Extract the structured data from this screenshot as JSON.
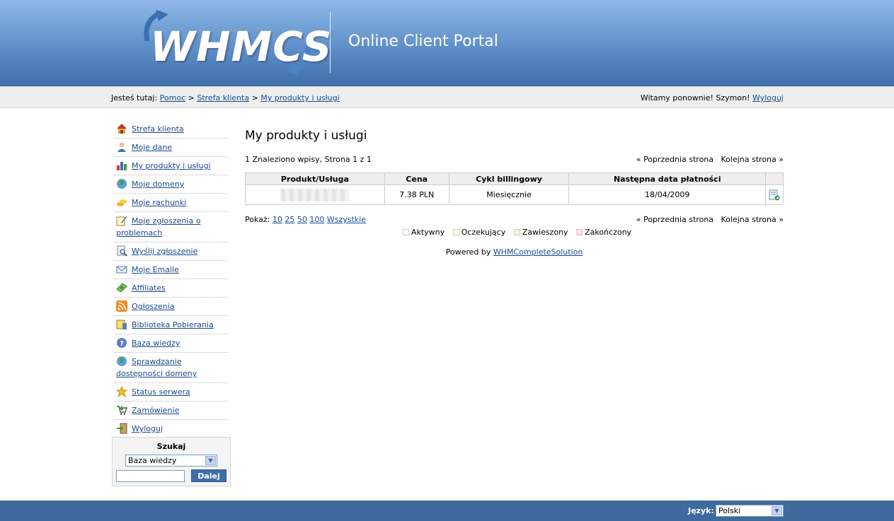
{
  "header": {
    "logo_text": "WHMCS",
    "portal_title": "Online Client Portal"
  },
  "breadcrumb": {
    "prefix": "Jesteś tutaj:",
    "items": [
      "Pomoc",
      "Strefa klienta",
      "My produkty i usługi"
    ],
    "separator": ">"
  },
  "welcome": {
    "text": "Witamy ponownie! Szymon!",
    "logout": "Wyloguj"
  },
  "sidebar": {
    "items": [
      {
        "label": "Strefa klienta",
        "icon": "home-icon"
      },
      {
        "label": "Moje dane",
        "icon": "user-icon"
      },
      {
        "label": "My produkty i usługi",
        "icon": "bar-chart-icon"
      },
      {
        "label": "Moje domeny",
        "icon": "globe-icon"
      },
      {
        "label": "Moje rachunki",
        "icon": "coins-icon"
      },
      {
        "label": "Moje zgłoszenia o problemach",
        "icon": "ticket-edit-icon"
      },
      {
        "label": "Wyślij zgłoszenie",
        "icon": "magnifier-doc-icon"
      },
      {
        "label": "Moje Emaile",
        "icon": "envelope-icon"
      },
      {
        "label": "Affiliates",
        "icon": "money-icon"
      },
      {
        "label": "Ogłoszenia",
        "icon": "rss-icon"
      },
      {
        "label": "Biblioteka Pobierania",
        "icon": "download-icon"
      },
      {
        "label": "Baza wiedzy",
        "icon": "help-icon"
      },
      {
        "label": "Sprawdzanie dostępności domeny",
        "icon": "globe-check-icon"
      },
      {
        "label": "Status serwera",
        "icon": "star-icon"
      },
      {
        "label": "Zamówienie",
        "icon": "cart-icon"
      },
      {
        "label": "Wyloguj",
        "icon": "logout-icon"
      }
    ]
  },
  "search": {
    "title": "Szukaj",
    "selected": "Baza wiedzy",
    "input_value": "",
    "button": "Dalej"
  },
  "main": {
    "title": "My produkty i usługi",
    "summary": "1 Znaleziono wpisy, Strona 1 z 1",
    "prev": "« Poprzednia strona",
    "next": "Kolejna strona »",
    "table": {
      "headers": [
        "Produkt/Usługa",
        "Cena",
        "Cykl billingowy",
        "Następna data płatności",
        ""
      ],
      "rows": [
        {
          "product": "",
          "price": "7.38 PLN",
          "cycle": "Miesięcznie",
          "next_due": "18/04/2009"
        }
      ]
    },
    "show_label": "Pokaż:",
    "show_options": [
      "10",
      "25",
      "50",
      "100",
      "Wszystkie"
    ],
    "legend": [
      {
        "label": "Aktywny",
        "color": "#ffffff"
      },
      {
        "label": "Oczekujący",
        "color": "#ffffdd"
      },
      {
        "label": "Zawieszony",
        "color": "#e8f8e0"
      },
      {
        "label": "Zakończony",
        "color": "#fde0e0"
      }
    ],
    "powered_prefix": "Powered by",
    "powered_link": "WHMCompleteSolution"
  },
  "footer": {
    "lang_label": "Język:",
    "lang_selected": "Polski"
  },
  "colors": {
    "header_top": "#8fb9e8",
    "header_bottom": "#3f6ea8",
    "footer": "#3f6a9e",
    "link": "#1a4a8c"
  }
}
